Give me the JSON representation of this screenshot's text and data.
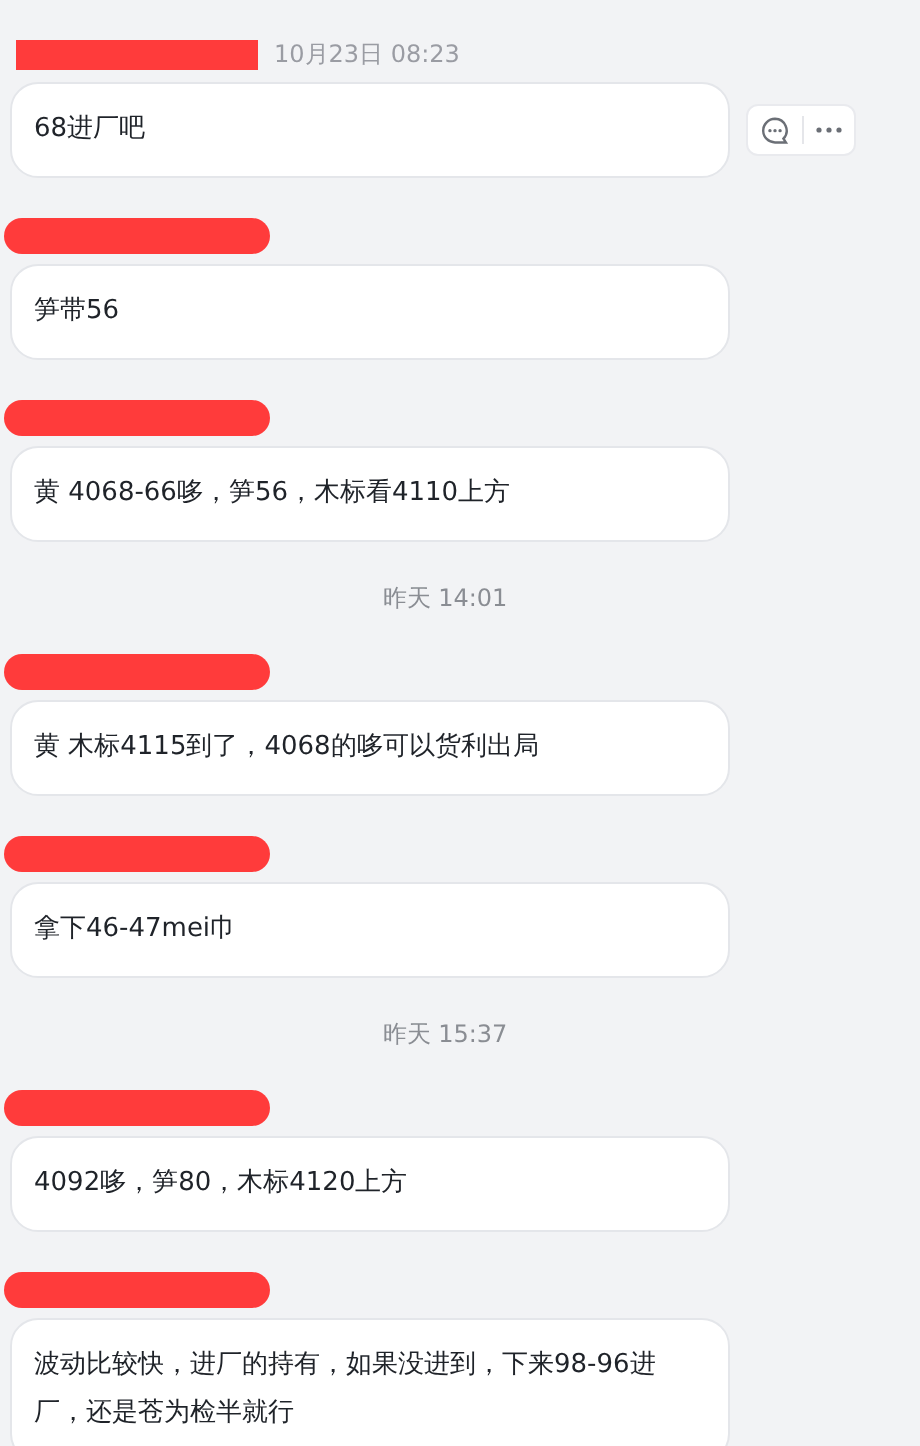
{
  "messages": [
    {
      "kind": "message",
      "redacted_sender": true,
      "time": "10月23日 08:23",
      "text": "68进厂吧",
      "show_actions": true
    },
    {
      "kind": "message",
      "redacted_sender": true,
      "text": "笋带56",
      "show_actions": false
    },
    {
      "kind": "message",
      "redacted_sender": true,
      "text": "黄 4068-66哆，笋56，木标看4110上方",
      "show_actions": false
    },
    {
      "kind": "timestamp",
      "text": "昨天 14:01"
    },
    {
      "kind": "message",
      "redacted_sender": true,
      "text": "黄 木标4115到了，4068的哆可以货利出局",
      "show_actions": false
    },
    {
      "kind": "message",
      "redacted_sender": true,
      "text": "拿下46-47mei巾",
      "show_actions": false
    },
    {
      "kind": "timestamp",
      "text": "昨天 15:37"
    },
    {
      "kind": "message",
      "redacted_sender": true,
      "text": "4092哆，笋80，木标4120上方",
      "show_actions": false
    },
    {
      "kind": "message",
      "redacted_sender": true,
      "text": "波动比较快，进厂的持有，如果没进到，下来98-96进厂，还是苍为检半就行",
      "show_actions": false
    }
  ]
}
